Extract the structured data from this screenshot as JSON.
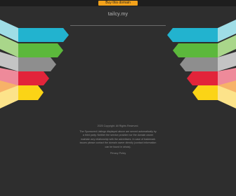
{
  "topbar": {
    "buy_label": "Buy this domain"
  },
  "page": {
    "domain": "tailcy.my"
  },
  "footer": {
    "notice": "2025 Copyright. All Rights Reserved.",
    "description": "The Sponsored Listings displayed above are served automatically by a third party. Neither the service provider nor the domain owner maintain any relationship with the advertisers. In case of trademark issues please contact the domain owner directly (contact information can be found in whois).",
    "privacy": "Privacy Policy"
  },
  "colors": {
    "background": "#2e2e2e",
    "topbar": "#1e1e1e",
    "button": "#f4a21a",
    "stripes": [
      "#22b3cf",
      "#5cb83c",
      "#8e8e8e",
      "#e2243a",
      "#fbd416"
    ],
    "light_stripes": [
      "#9fdde6",
      "#a9d68a",
      "#c4c4c4",
      "#ee8a9a",
      "#fce38a"
    ]
  }
}
